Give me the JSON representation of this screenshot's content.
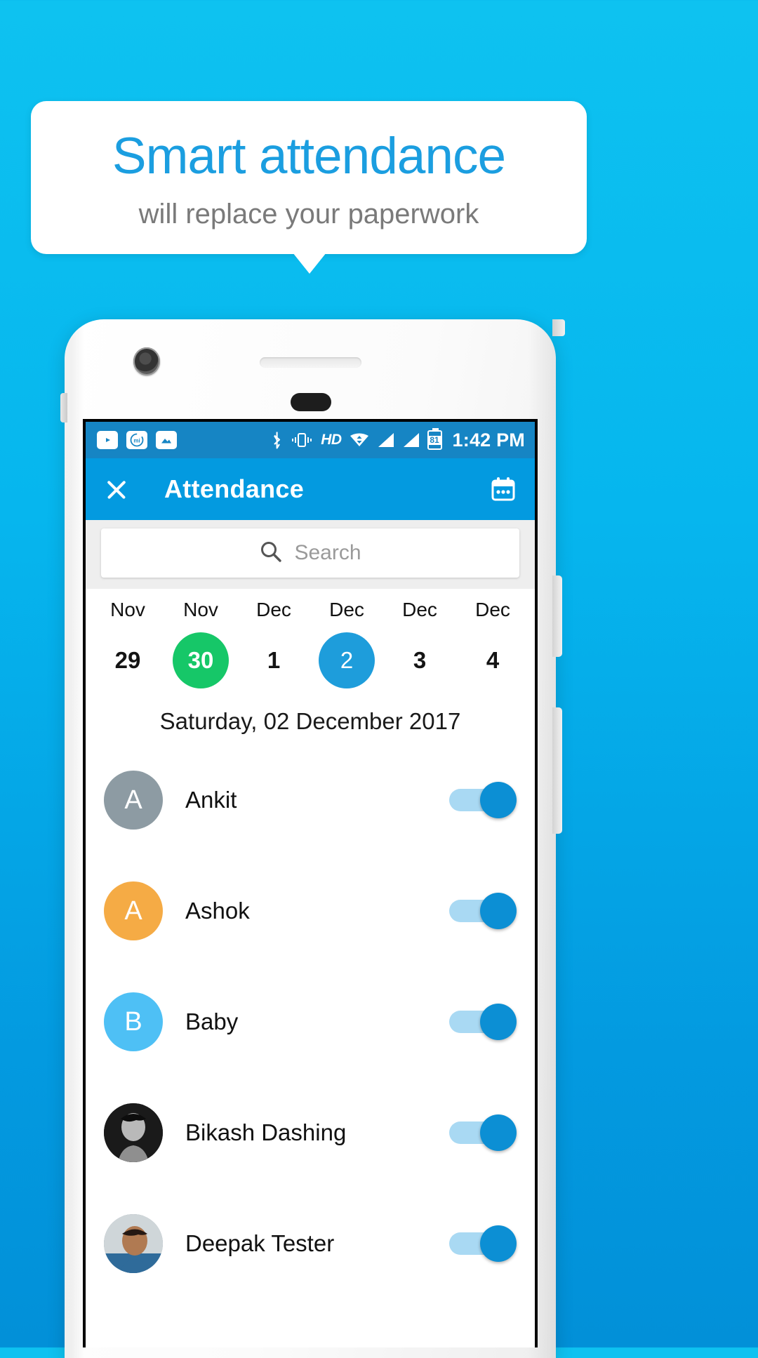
{
  "promo": {
    "title": "Smart attendance",
    "subtitle": "will replace your paperwork",
    "title_color": "#1b9ee0",
    "subtitle_color": "#7a7a7a",
    "background_color": "#06b6ee"
  },
  "statusbar": {
    "left_icons": [
      "youtube-icon",
      "mi-app-icon",
      "gallery-icon"
    ],
    "right_icons": [
      "bluetooth-icon",
      "vibrate-icon",
      "hd-icon",
      "wifi-icon",
      "signal-icon",
      "signal-icon",
      "battery-icon"
    ],
    "hd_label": "HD",
    "battery_level": "81",
    "time": "1:42 PM",
    "background_color": "#1685c4"
  },
  "toolbar": {
    "close_icon": "close-icon",
    "title": "Attendance",
    "calendar_icon": "calendar-icon",
    "background_color": "#039ae0"
  },
  "search": {
    "icon": "search-icon",
    "placeholder": "Search",
    "value": ""
  },
  "date_strip": {
    "days": [
      {
        "month": "Nov",
        "day": "29",
        "state": "normal"
      },
      {
        "month": "Nov",
        "day": "30",
        "state": "today"
      },
      {
        "month": "Dec",
        "day": "1",
        "state": "normal"
      },
      {
        "month": "Dec",
        "day": "2",
        "state": "selected"
      },
      {
        "month": "Dec",
        "day": "3",
        "state": "normal"
      },
      {
        "month": "Dec",
        "day": "4",
        "state": "normal"
      }
    ],
    "today_color": "#16c768",
    "selected_color": "#1e9ddb"
  },
  "selected_date_heading": "Saturday, 02 December 2017",
  "attendance_list": [
    {
      "name": "Ankit",
      "avatar_type": "initial",
      "initial": "A",
      "avatar_color": "#8d9ba3",
      "present": true
    },
    {
      "name": "Ashok",
      "avatar_type": "initial",
      "initial": "A",
      "avatar_color": "#f5ab45",
      "present": true
    },
    {
      "name": "Baby",
      "avatar_type": "initial",
      "initial": "B",
      "avatar_color": "#4ec0f5",
      "present": true
    },
    {
      "name": "Bikash Dashing",
      "avatar_type": "photo",
      "initial": "",
      "avatar_color": "#2b2b2b",
      "present": true
    },
    {
      "name": "Deepak Tester",
      "avatar_type": "photo",
      "initial": "",
      "avatar_color": "#7f8d99",
      "present": true
    }
  ],
  "toggle": {
    "track_color": "#a9d9f3",
    "knob_color": "#0c8fd4"
  }
}
